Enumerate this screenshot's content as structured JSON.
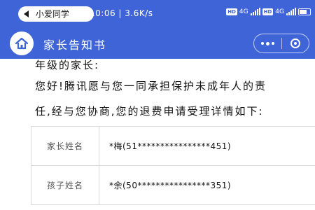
{
  "status_bar": {
    "back_app_label": "小爱同学",
    "time": "10:06",
    "network_speed": "3.6K/s",
    "hd_badge": "HD",
    "network_type": "4G",
    "battery_level": "4"
  },
  "nav": {
    "home_icon": "home-icon",
    "title": "家长告知书",
    "more_icon": "more-dots-icon",
    "close_icon": "close-circle-icon"
  },
  "letter": {
    "line1": "年级的家长:",
    "line2": "您好!腾讯愿与您一同承担保护未成年人的责",
    "line3": "任,经与您协商,您的退费申请受理详情如下:"
  },
  "table": {
    "rows": [
      {
        "label": "家长姓名",
        "value": "*梅(51****************451)"
      },
      {
        "label": "孩子姓名",
        "value": "*余(50****************351)"
      }
    ]
  },
  "colors": {
    "brand_blue": "#3f64d8",
    "background": "#ffffff",
    "table_border": "#d9d9d9"
  }
}
